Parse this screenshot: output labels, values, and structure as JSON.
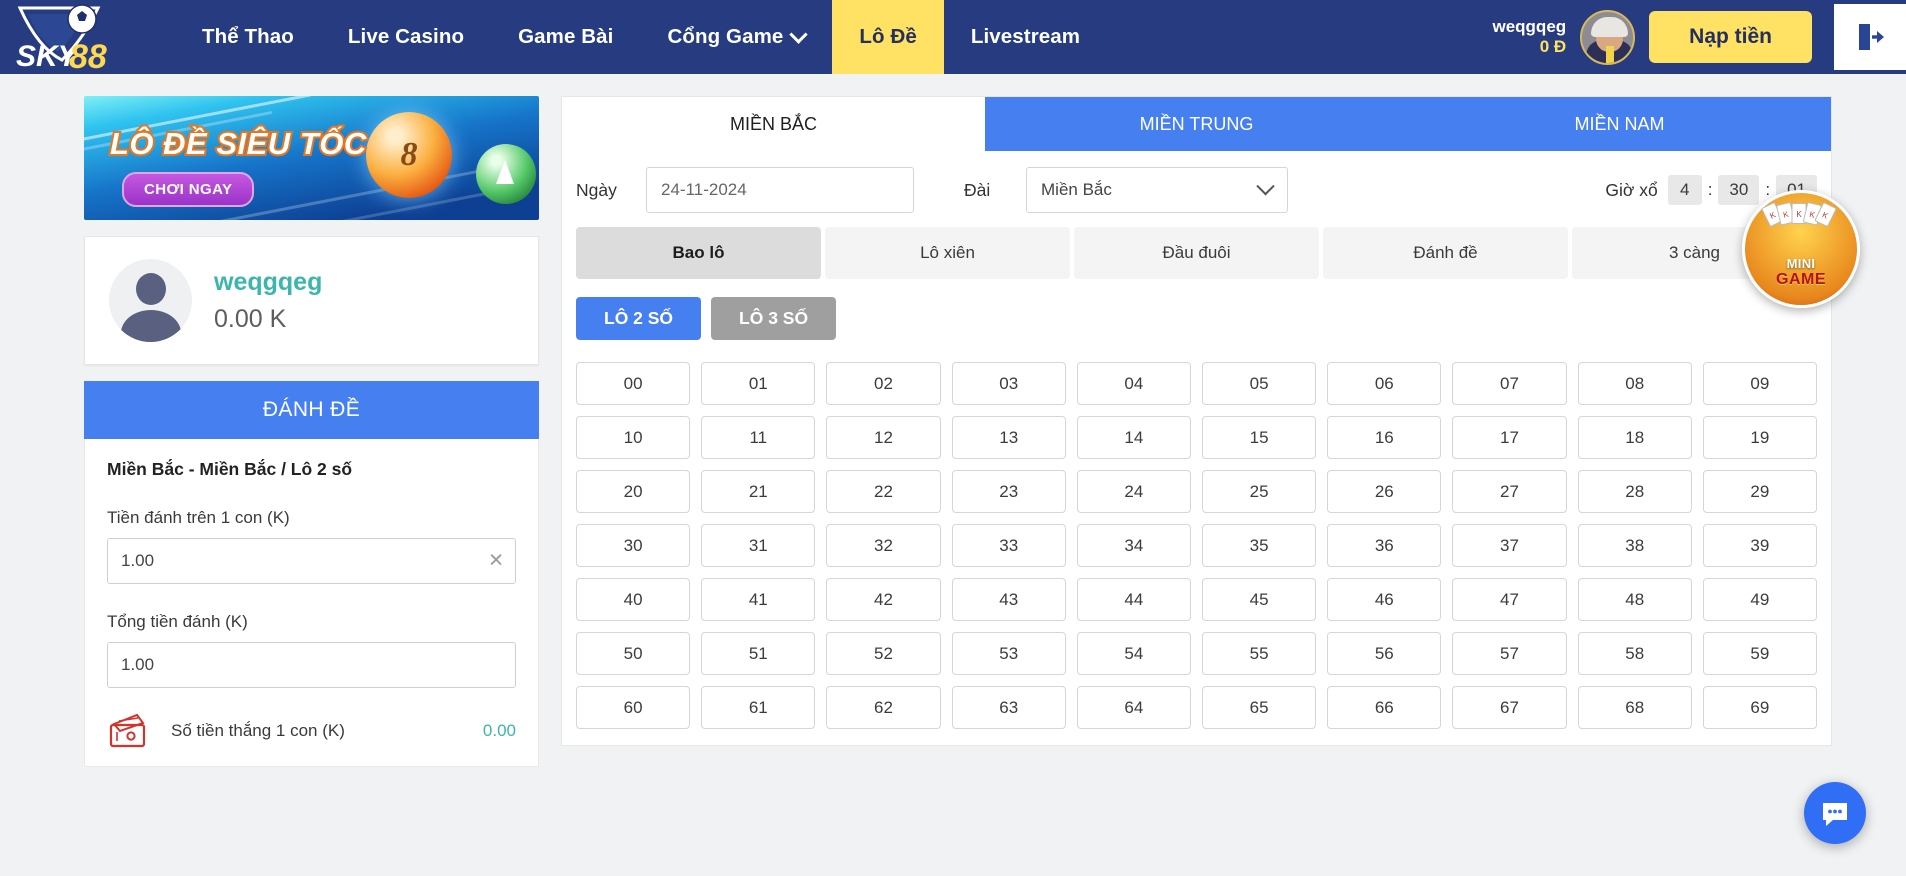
{
  "header": {
    "logo_text_1": "SKY",
    "logo_text_2": "88",
    "nav": [
      {
        "label": "Thể Thao",
        "active": false,
        "caret": false
      },
      {
        "label": "Live Casino",
        "active": false,
        "caret": false
      },
      {
        "label": "Game Bài",
        "active": false,
        "caret": false
      },
      {
        "label": "Cổng Game",
        "active": false,
        "caret": true
      },
      {
        "label": "Lô Đề",
        "active": true,
        "caret": false
      },
      {
        "label": "Livestream",
        "active": false,
        "caret": false
      }
    ],
    "user_name": "weqgqeg",
    "user_balance": "0 Đ",
    "deposit_label": "Nạp tiền"
  },
  "sidebar": {
    "banner": {
      "title": "LÔ ĐỀ SIÊU TỐC",
      "cta": "CHƠI NGAY",
      "ball_number": "8"
    },
    "profile": {
      "name": "weqgqeg",
      "balance": "0.00 K"
    },
    "bet": {
      "header": "ĐÁNH ĐỀ",
      "subtitle": "Miền Bắc - Miền Bắc / Lô 2 số",
      "amount_label": "Tiền đánh trên 1 con (K)",
      "amount_value": "1.00",
      "total_label": "Tổng tiền đánh (K)",
      "total_value": "1.00",
      "win_label": "Số tiền thắng 1 con (K)",
      "win_value": "0.00"
    }
  },
  "main": {
    "region_tabs": [
      {
        "label": "MIỀN BẮC",
        "active": false
      },
      {
        "label": "MIỀN TRUNG",
        "active": true
      },
      {
        "label": "MIỀN NAM",
        "active": true
      }
    ],
    "filter": {
      "date_label": "Ngày",
      "date_value": "24-11-2024",
      "station_label": "Đài",
      "station_value": "Miền Bắc",
      "time_label": "Giờ xổ",
      "time_hour": "4",
      "time_min": "30",
      "time_sec": "01",
      "sep": ":"
    },
    "bet_types": [
      {
        "label": "Bao lô",
        "active": true
      },
      {
        "label": "Lô xiên",
        "active": false
      },
      {
        "label": "Đầu đuôi",
        "active": false
      },
      {
        "label": "Đánh đề",
        "active": false
      },
      {
        "label": "3 càng",
        "active": false
      }
    ],
    "sub_tabs": [
      {
        "label": "LÔ 2 SỐ",
        "active": true
      },
      {
        "label": "LÔ 3 SỐ",
        "active": false
      }
    ],
    "numbers": [
      "00",
      "01",
      "02",
      "03",
      "04",
      "05",
      "06",
      "07",
      "08",
      "09",
      "10",
      "11",
      "12",
      "13",
      "14",
      "15",
      "16",
      "17",
      "18",
      "19",
      "20",
      "21",
      "22",
      "23",
      "24",
      "25",
      "26",
      "27",
      "28",
      "29",
      "30",
      "31",
      "32",
      "33",
      "34",
      "35",
      "36",
      "37",
      "38",
      "39",
      "40",
      "41",
      "42",
      "43",
      "44",
      "45",
      "46",
      "47",
      "48",
      "49",
      "50",
      "51",
      "52",
      "53",
      "54",
      "55",
      "56",
      "57",
      "58",
      "59",
      "60",
      "61",
      "62",
      "63",
      "64",
      "65",
      "66",
      "67",
      "68",
      "69"
    ]
  },
  "widgets": {
    "minigame_line1": "MINI",
    "minigame_line2": "GAME"
  },
  "colors": {
    "header_bg": "#263b80",
    "accent_yellow": "#ffe263",
    "accent_blue": "#4680f0",
    "teal": "#3cb5ad"
  }
}
